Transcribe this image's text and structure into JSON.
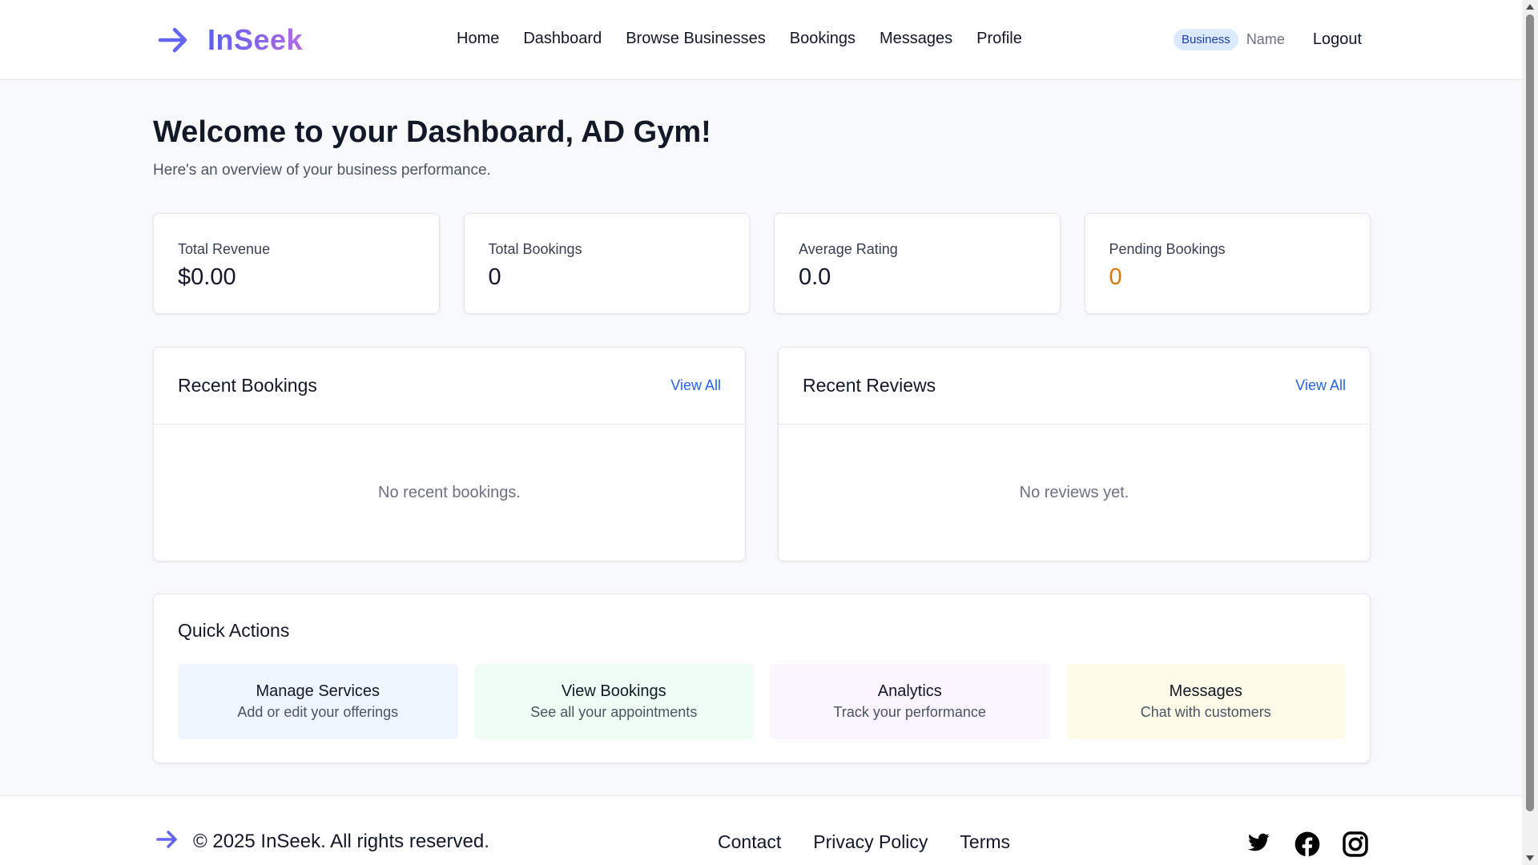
{
  "header": {
    "logo_text": "InSeek",
    "nav": [
      "Home",
      "Dashboard",
      "Browse Businesses",
      "Bookings",
      "Messages",
      "Profile"
    ],
    "role_badge": "Business",
    "user_name": "Name",
    "logout_label": "Logout"
  },
  "main": {
    "title": "Welcome to your Dashboard, AD Gym!",
    "subtitle": "Here's an overview of your business performance.",
    "stats": [
      {
        "label": "Total Revenue",
        "value": "$0.00"
      },
      {
        "label": "Total Bookings",
        "value": "0"
      },
      {
        "label": "Average Rating",
        "value": "0.0"
      },
      {
        "label": "Pending Bookings",
        "value": "0",
        "color": "#d97706"
      }
    ],
    "recent_bookings": {
      "title": "Recent Bookings",
      "view_all": "View All",
      "empty": "No recent bookings."
    },
    "recent_reviews": {
      "title": "Recent Reviews",
      "view_all": "View All",
      "empty": "No reviews yet."
    },
    "quick_actions": {
      "title": "Quick Actions",
      "items": [
        {
          "title": "Manage Services",
          "description": "Add or edit your offerings",
          "bg": "#eff6ff"
        },
        {
          "title": "View Bookings",
          "description": "See all your appointments",
          "bg": "#f0fdf4"
        },
        {
          "title": "Analytics",
          "description": "Track your performance",
          "bg": "#faf5ff"
        },
        {
          "title": "Messages",
          "description": "Chat with customers",
          "bg": "#fefce8"
        }
      ]
    }
  },
  "footer": {
    "copyright": "© 2025 InSeek. All rights reserved.",
    "links": [
      "Contact",
      "Privacy Policy",
      "Terms"
    ],
    "socials": [
      "twitter-icon",
      "facebook-icon",
      "instagram-icon"
    ]
  },
  "colors": {
    "accent": "#2563eb",
    "logo_gradient_start": "#5b5ff0",
    "logo_gradient_end": "#b36ae8",
    "pending": "#d97706"
  }
}
